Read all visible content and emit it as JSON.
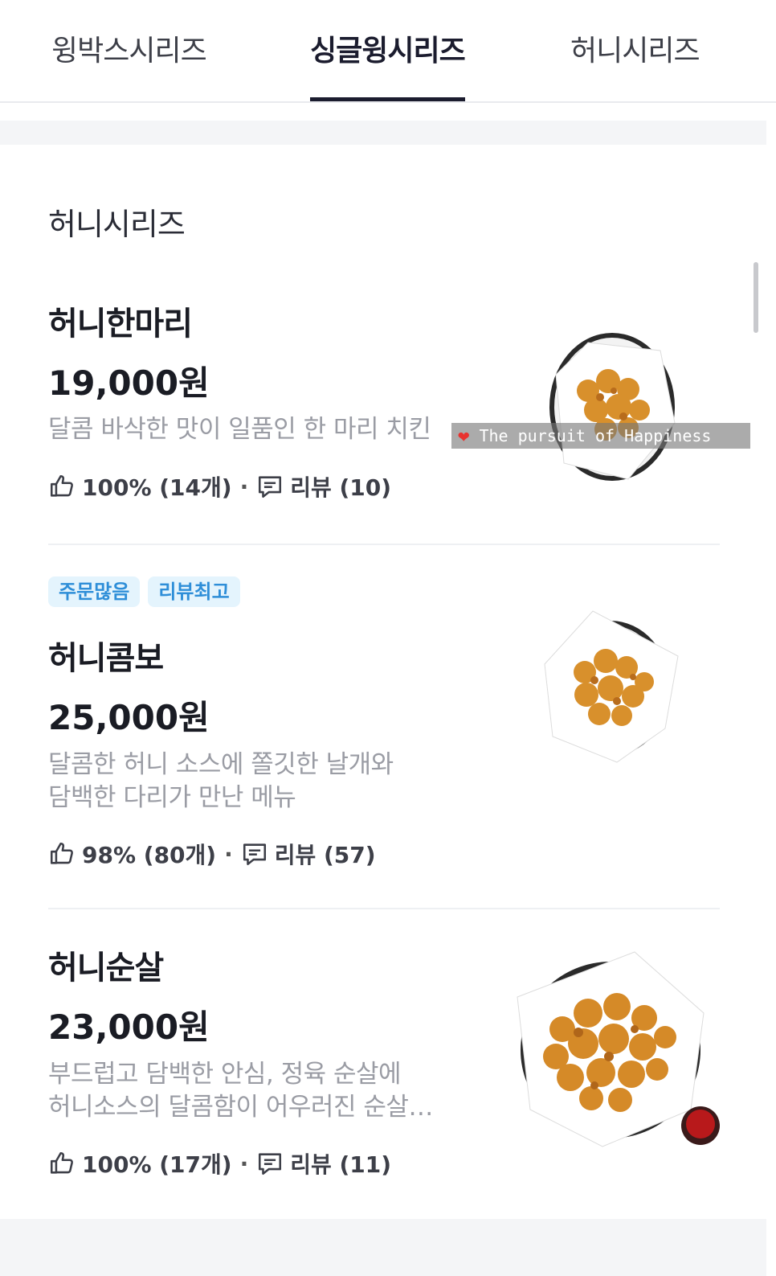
{
  "tabs": [
    {
      "label": "윙박스시리즈",
      "active": false
    },
    {
      "label": "싱글윙시리즈",
      "active": true
    },
    {
      "label": "허니시리즈",
      "active": false
    }
  ],
  "section": {
    "title": "허니시리즈"
  },
  "items": [
    {
      "name": "허니한마리",
      "price": "19,000원",
      "desc": [
        "달콤 바삭한 맛이 일품인 한 마리 치킨"
      ],
      "like": "100% (14개)",
      "review": "리뷰 (10)",
      "badges": []
    },
    {
      "name": "허니콤보",
      "price": "25,000원",
      "desc": [
        "달콤한 허니 소스에 쫄깃한 날개와",
        "담백한 다리가 만난 메뉴"
      ],
      "like": "98% (80개)",
      "review": "리뷰 (57)",
      "badges": [
        "주문많음",
        "리뷰최고"
      ]
    },
    {
      "name": "허니순살",
      "price": "23,000원",
      "desc": [
        "부드럽고 담백한 안심, 정육 순살에",
        "허니소스의 달콤함이 어우러진 순살…"
      ],
      "like": "100% (17개)",
      "review": "리뷰 (11)",
      "badges": []
    }
  ],
  "overlay": {
    "text": "The pursuit of Happiness",
    "icon": "heart-icon"
  },
  "colors": {
    "accent": "#1b1c2e",
    "badge_bg": "#e4f4fd",
    "badge_text": "#2e8ed8",
    "desc": "#9a9ca4"
  }
}
